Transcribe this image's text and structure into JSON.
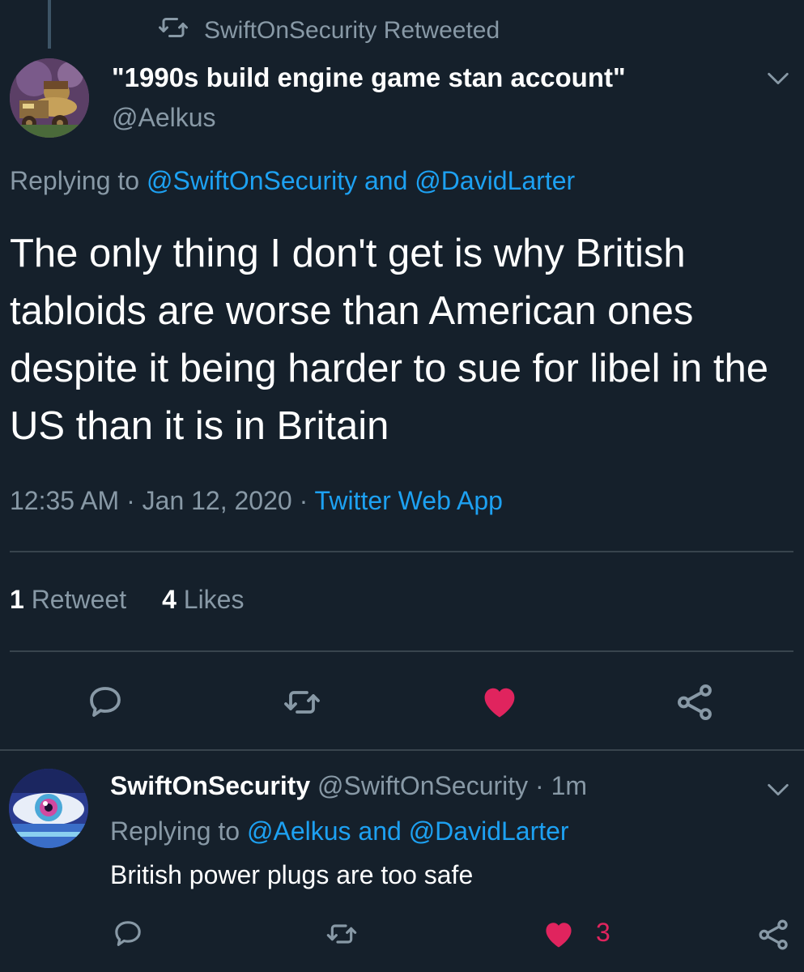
{
  "retweet_context": {
    "label": "SwiftOnSecurity Retweeted",
    "icon": "retweet-icon"
  },
  "main_tweet": {
    "display_name": "\"1990s build engine game stan account\"",
    "handle": "@Aelkus",
    "replying_prefix": "Replying to",
    "replying_mention_1": "@SwiftOnSecurity",
    "replying_and": "and",
    "replying_mention_2": "@DavidLarter",
    "text": "The only thing I don't get is why British tabloids are worse than American ones despite it being harder to sue for libel in the US than it is in Britain",
    "time": "12:35 AM",
    "date": "Jan 12, 2020",
    "separator": "·",
    "source": "Twitter Web App",
    "retweet_count": "1",
    "retweet_label": "Retweet",
    "like_count": "4",
    "like_label": "Likes",
    "liked": true
  },
  "reply_tweet": {
    "display_name": "SwiftOnSecurity",
    "handle": "@SwiftOnSecurity",
    "separator": "·",
    "time_ago": "1m",
    "replying_prefix": "Replying to",
    "replying_mention_1": "@Aelkus",
    "replying_and": "and",
    "replying_mention_2": "@DavidLarter",
    "text": "British power plugs are too safe",
    "like_count": "3",
    "liked": true
  },
  "colors": {
    "background": "#15202b",
    "text_primary": "#ffffff",
    "text_secondary": "#8899a6",
    "link": "#1da1f2",
    "like": "#e0245e",
    "divider": "#38444d"
  }
}
